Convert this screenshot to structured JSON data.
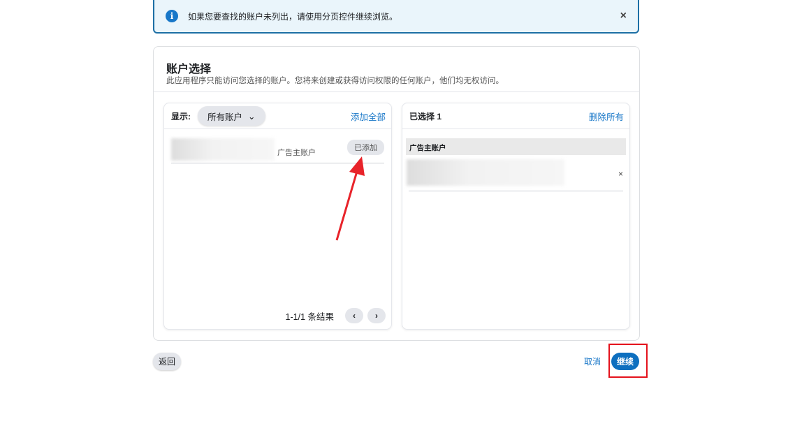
{
  "banner": {
    "text": "如果您要查找的账户未列出，请使用分页控件继续浏览。",
    "close": "×",
    "icon": "info-icon"
  },
  "card": {
    "title": "账户选择",
    "subtitle": "此应用程序只能访问您选择的账户。您将来创建或获得访问权限的任何账户，他们均无权访问。"
  },
  "left": {
    "show_label": "显示:",
    "filter": "所有账户",
    "add_all": "添加全部",
    "item": {
      "type": "广告主账户",
      "status": "已添加"
    },
    "pagination": {
      "text": "1-1/1 条结果",
      "prev": "‹",
      "next": "›"
    }
  },
  "right": {
    "selected": "已选择 1",
    "remove_all": "删除所有",
    "section": "广告主账户",
    "remove": "×"
  },
  "footer": {
    "back": "返回",
    "cancel": "取消",
    "continue": "继续"
  },
  "colors": {
    "accent": "#1877c8",
    "highlight": "#e4121c"
  }
}
